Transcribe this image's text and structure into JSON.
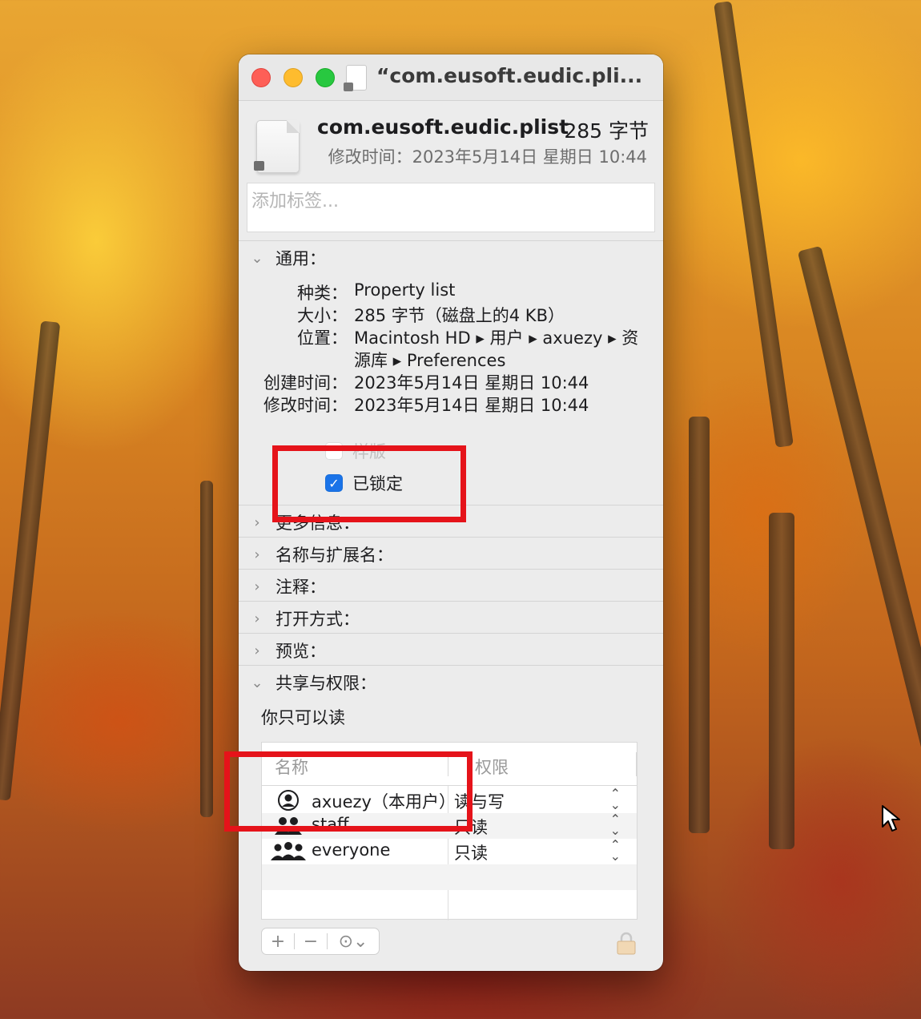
{
  "window": {
    "title": "“com.eusoft.eudic.pli..."
  },
  "file": {
    "name": "com.eusoft.eudic.plist",
    "size": "285 字节",
    "modified": "修改时间：2023年5月14日 星期日 10:44"
  },
  "tags": {
    "placeholder": "添加标签..."
  },
  "general": {
    "header": "通用：",
    "kind_label": "种类：",
    "kind_value": "Property list",
    "size_label": "大小：",
    "size_value": "285 字节（磁盘上的4 KB）",
    "where_label": "位置：",
    "where_value_line1": "Macintosh HD ▸ 用户 ▸ axuezy ▸ 资",
    "where_value_line2": "源库 ▸ Preferences",
    "created_label": "创建时间：",
    "created_value": "2023年5月14日 星期日 10:44",
    "modified_label": "修改时间：",
    "modified_value": "2023年5月14日 星期日 10:44",
    "stationery_label": "样版",
    "locked_label": "已锁定"
  },
  "sections": {
    "more_info": "更多信息：",
    "name_ext": "名称与扩展名：",
    "comments": "注释：",
    "open_with": "打开方式：",
    "preview": "预览：",
    "sharing": "共享与权限："
  },
  "sharing": {
    "summary": "你只可以读",
    "col_name": "名称",
    "col_privilege": "权限",
    "rows": [
      {
        "name": "axuezy（本用户）",
        "privilege": "读与写"
      },
      {
        "name": "staff",
        "privilege": "只读"
      },
      {
        "name": "everyone",
        "privilege": "只读"
      }
    ]
  },
  "toolbar": {
    "add": "+",
    "remove": "−",
    "action": "⊙⌄"
  },
  "colors": {
    "annotation": "#e5131a",
    "checkbox_checked": "#1a73e8"
  }
}
